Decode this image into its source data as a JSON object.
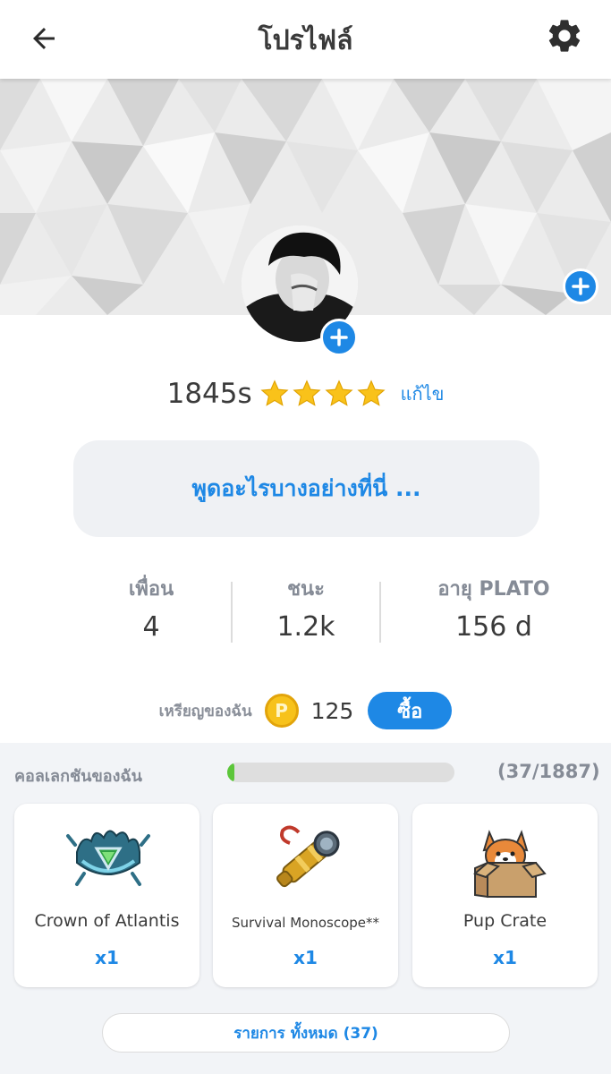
{
  "header": {
    "title": "โปรไฟล์",
    "back_icon": "arrow-left-icon",
    "settings_icon": "gear-icon"
  },
  "profile": {
    "username": "1845s",
    "stars": 4,
    "edit_label": "แก้ไข",
    "status_placeholder": "พูดอะไรบางอย่างที่นี่ ..."
  },
  "stats": [
    {
      "label": "เพื่อน",
      "value": "4"
    },
    {
      "label": "ชนะ",
      "value": "1.2k"
    },
    {
      "label": "อายุ PLATO",
      "value": "156 d"
    }
  ],
  "coins": {
    "label": "เหรียญของฉัน",
    "icon_letter": "P",
    "count": "125",
    "buy_label": "ซื้อ"
  },
  "collection": {
    "title": "คอลเลกชันของฉัน",
    "progress_text": "(37/1887)",
    "progress_fraction": 0.0196,
    "items": [
      {
        "name": "Crown of Atlantis",
        "qty": "x1",
        "icon": "crown-icon"
      },
      {
        "name": "Survival Monoscope**",
        "qty": "x1",
        "icon": "monoscope-icon"
      },
      {
        "name": "Pup Crate",
        "qty": "x1",
        "icon": "pup-crate-icon"
      }
    ],
    "view_all_label": "รายการ ทั้งหมด (37)"
  },
  "colors": {
    "accent": "#1e88e5",
    "star": "#f9c21a",
    "progress": "#5cc63a",
    "coin": "#f7c21b"
  }
}
